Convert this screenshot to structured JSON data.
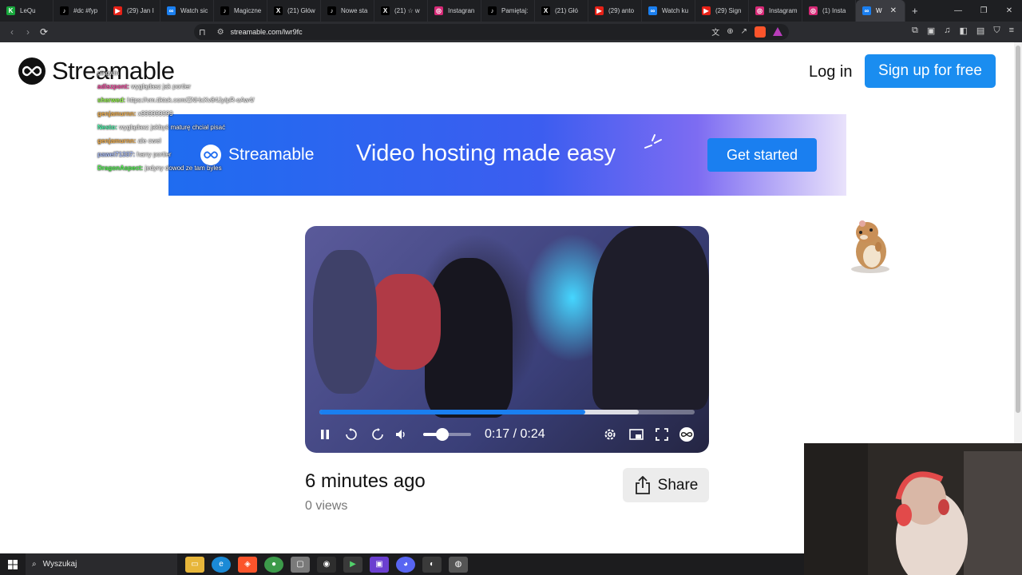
{
  "browser": {
    "tabs": [
      {
        "title": "LeQu",
        "fav_color": "#18a73c",
        "fav": "K"
      },
      {
        "title": "#dc #fyp",
        "fav_color": "#000000",
        "fav": "♪"
      },
      {
        "title": "(29) Jan I",
        "fav_color": "#e62117",
        "fav": "▶"
      },
      {
        "title": "Watch sic",
        "fav_color": "#1a7ff0",
        "fav": "∞"
      },
      {
        "title": "Magiczne",
        "fav_color": "#000000",
        "fav": "♪"
      },
      {
        "title": "(21) Głów",
        "fav_color": "#000000",
        "fav": "X"
      },
      {
        "title": "Nowe sta",
        "fav_color": "#000000",
        "fav": "♪"
      },
      {
        "title": "(21) ☆ w",
        "fav_color": "#000000",
        "fav": "X"
      },
      {
        "title": "Instagran",
        "fav_color": "#d62976",
        "fav": "◎"
      },
      {
        "title": "Pamiętaj:",
        "fav_color": "#000000",
        "fav": "♪"
      },
      {
        "title": "(21) Głó",
        "fav_color": "#000000",
        "fav": "X"
      },
      {
        "title": "(29) anto",
        "fav_color": "#e62117",
        "fav": "▶"
      },
      {
        "title": "Watch ku",
        "fav_color": "#1a7ff0",
        "fav": "∞"
      },
      {
        "title": "(29) Sign",
        "fav_color": "#e62117",
        "fav": "▶"
      },
      {
        "title": "Instagram",
        "fav_color": "#d62976",
        "fav": "◎"
      },
      {
        "title": "(1) Insta",
        "fav_color": "#d62976",
        "fav": "◎"
      },
      {
        "title": "W",
        "fav_color": "#1a7ff0",
        "fav": "∞",
        "active": true
      }
    ],
    "new_tab": "+",
    "url": "streamable.com/lwr9fc"
  },
  "site": {
    "brand": "Streamable",
    "login": "Log in",
    "signup": "Sign up for free",
    "accent": "#1a8df0"
  },
  "chat": [
    {
      "user": "",
      "msg": "pingwin",
      "color": "#4fa3ff"
    },
    {
      "user": "adiszpont:",
      "msg": "wyglądasz jak portier",
      "color": "#ff4fa8"
    },
    {
      "user": "sherwed:",
      "msg": "https://vm.tiktok.com/ZNHxXv84Jy/pR-oAw4/",
      "color": "#9bff4f"
    },
    {
      "user": "genjamurnn:",
      "msg": "x999999999",
      "color": "#ffb84f"
    },
    {
      "user": "Nesto:",
      "msg": "wyglądasz jakbyś maturę chciał pisać",
      "color": "#4fffb2"
    },
    {
      "user": "genjamurnn:",
      "msg": "ale cwel",
      "color": "#ffb84f"
    },
    {
      "user": "pawel71337:",
      "msg": "harry portier",
      "color": "#b0c4ff"
    },
    {
      "user": "DragonAspect:",
      "msg": "jedyny dowod ze tam byles",
      "color": "#55ff55"
    }
  ],
  "banner": {
    "brand": "Streamable",
    "tagline": "Video hosting made easy",
    "cta": "Get started"
  },
  "video": {
    "time": "0:17 / 0:24",
    "played": 0.708,
    "buffered": 0.85,
    "volume": 0.4
  },
  "meta": {
    "uploaded": "6 minutes ago",
    "views": "0 views",
    "share": "Share"
  },
  "taskbar": {
    "search": "Wyszukaj"
  }
}
